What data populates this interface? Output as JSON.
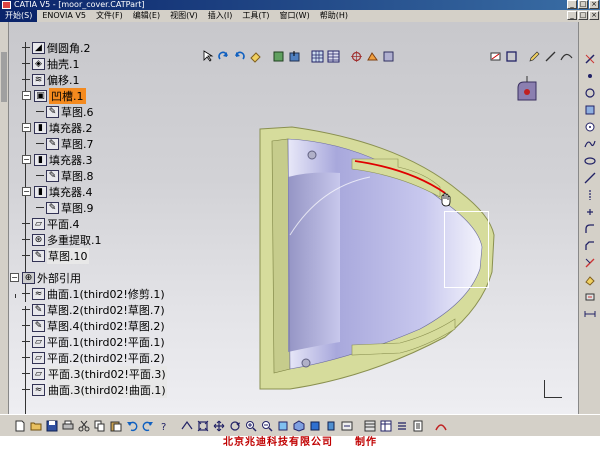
{
  "window": {
    "title": "CATIA V5 - [moor_cover.CATPart]",
    "controls": [
      "_",
      "□",
      "×"
    ]
  },
  "menubar": {
    "items": [
      "开始(S)",
      "ENOVIA V5",
      "文件(F)",
      "编辑(E)",
      "视图(V)",
      "插入(I)",
      "工具(T)",
      "窗口(W)",
      "帮助(H)"
    ],
    "doc_controls": [
      "_",
      "□",
      "×"
    ]
  },
  "tree": {
    "items": [
      {
        "label": "倒圆角.2",
        "indent": 1
      },
      {
        "label": "抽壳.1",
        "indent": 1
      },
      {
        "label": "偏移.1",
        "indent": 1
      },
      {
        "label": "凹槽.1",
        "indent": 1,
        "highlight": true
      },
      {
        "label": "草图.6",
        "indent": 2
      },
      {
        "label": "填充器.2",
        "indent": 1
      },
      {
        "label": "草图.7",
        "indent": 2
      },
      {
        "label": "填充器.3",
        "indent": 1
      },
      {
        "label": "草图.8",
        "indent": 2
      },
      {
        "label": "填充器.4",
        "indent": 1
      },
      {
        "label": "草图.9",
        "indent": 2
      },
      {
        "label": "平面.4",
        "indent": 1
      },
      {
        "label": "多重提取.1",
        "indent": 1
      },
      {
        "label": "草图.10",
        "indent": 1
      },
      {
        "label": "外部引用",
        "indent": 0
      },
      {
        "label": "曲面.1(third02!修剪.1)",
        "indent": 1
      },
      {
        "label": "草图.2(third02!草图.7)",
        "indent": 1
      },
      {
        "label": "草图.4(third02!草图.2)",
        "indent": 1
      },
      {
        "label": "平面.1(third02!平面.1)",
        "indent": 1
      },
      {
        "label": "平面.2(third02!平面.2)",
        "indent": 1
      },
      {
        "label": "平面.3(third02!平面.3)",
        "indent": 1
      },
      {
        "label": "曲面.3(third02!曲面.1)",
        "indent": 1
      }
    ]
  },
  "colors": {
    "highlight": "#f48a1e",
    "part_body": "#d6dc9c",
    "part_surface": "#b6b6e6",
    "edge_highlight": "#e00000",
    "footer_text": "#c00000"
  },
  "footer": {
    "credit": "北京兆迪科技有限公司　　制作"
  },
  "icons": {
    "top": [
      "cursor-icon",
      "rotate-icon",
      "redo-icon",
      "eraser-icon",
      "view-icon",
      "grid-icon",
      "snap-icon",
      "table-icon",
      "normal-view-icon",
      "measure-icon"
    ],
    "right": [
      "sketcher-icon",
      "point-icon",
      "circle-icon",
      "line-icon",
      "spline-icon",
      "ellipse-icon",
      "profile-icon",
      "axis-icon",
      "plane-icon",
      "fillet-icon",
      "chamfer-icon"
    ],
    "bottom": [
      "new-icon",
      "open-icon",
      "save-icon",
      "print-icon",
      "cut-icon",
      "copy-icon",
      "paste-icon",
      "undo-icon",
      "redo-icon",
      "help-icon",
      "fly-icon",
      "fit-all-icon",
      "pan-icon",
      "rotate-icon",
      "zoom-in-icon",
      "zoom-out-icon",
      "normal-icon",
      "iso-view-icon",
      "shading-icon",
      "hide-icon",
      "swap-icon",
      "apply-material-icon"
    ]
  }
}
